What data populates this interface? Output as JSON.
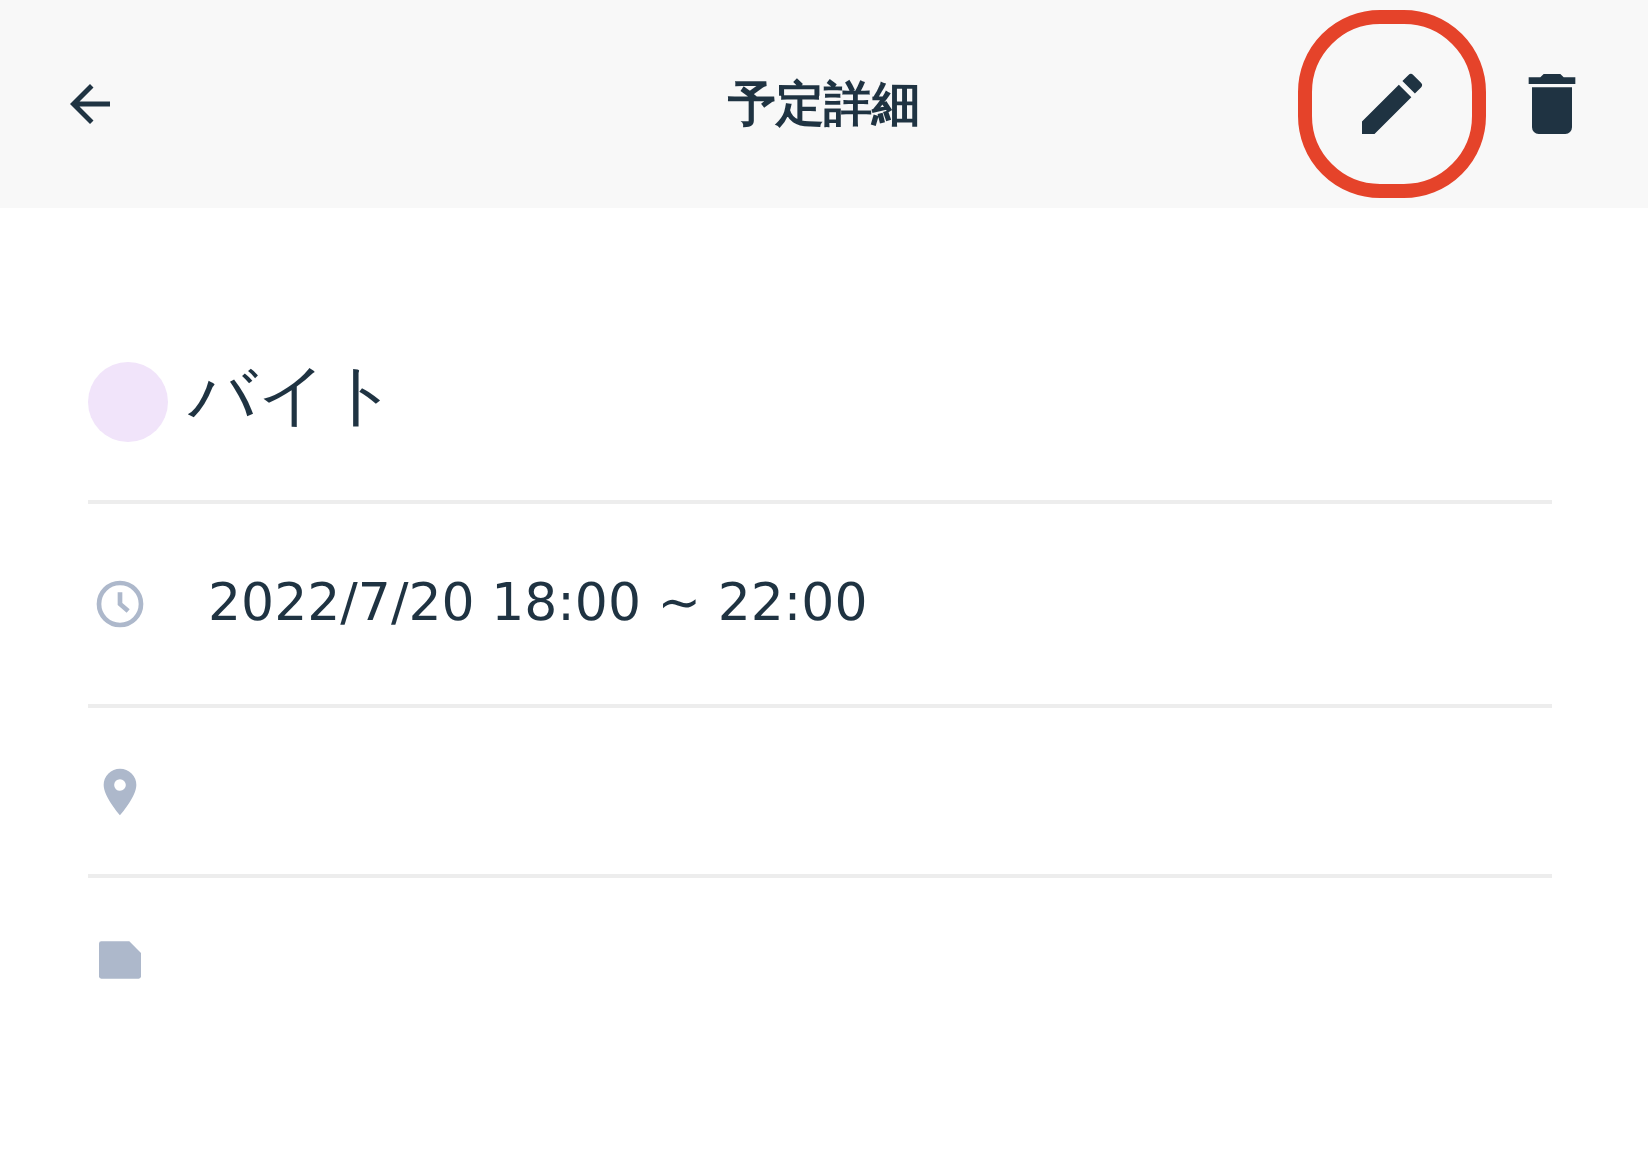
{
  "header": {
    "title": "予定詳細",
    "actions": [
      {
        "kind": "edit",
        "highlighted": true
      },
      {
        "kind": "delete"
      }
    ]
  },
  "event": {
    "title": "バイト",
    "color": "#f1e4fa"
  },
  "details": [
    {
      "kind": "time",
      "text": "2022/7/20 18:00 ~ 22:00"
    },
    {
      "kind": "location"
    },
    {
      "kind": "note"
    }
  ]
}
